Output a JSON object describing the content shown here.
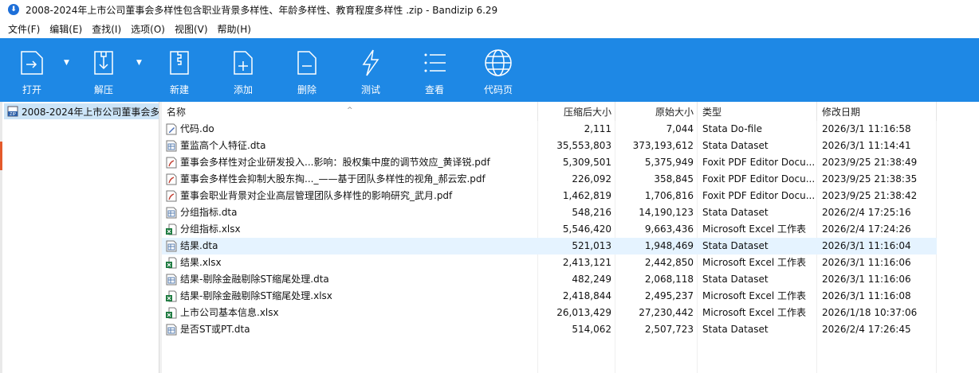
{
  "window": {
    "title": "2008-2024年上市公司董事会多样性包含职业背景多样性、年龄多样性、教育程度多样性 .zip - Bandizip 6.29"
  },
  "menu": [
    "文件(F)",
    "编辑(E)",
    "查找(I)",
    "选项(O)",
    "视图(V)",
    "帮助(H)"
  ],
  "toolbar": {
    "open": "打开",
    "extract": "解压",
    "new": "新建",
    "add": "添加",
    "delete": "删除",
    "test": "测试",
    "view": "查看",
    "codepage": "代码页"
  },
  "tree": {
    "root_label": "2008-2024年上市公司董事会多"
  },
  "columns": {
    "name": "名称",
    "packed": "压缩后大小",
    "size": "原始大小",
    "type": "类型",
    "modified": "修改日期"
  },
  "files": [
    {
      "name": "代码.do",
      "packed": "2,111",
      "size": "7,044",
      "type": "Stata Do-file",
      "modified": "2026/3/1 11:16:58",
      "icon": "do-file-icon"
    },
    {
      "name": "董监高个人特征.dta",
      "packed": "35,553,803",
      "size": "373,193,612",
      "type": "Stata Dataset",
      "modified": "2026/3/1 11:14:41",
      "icon": "dta-file-icon"
    },
    {
      "name": "董事会多样性对企业研发投入...影响：股权集中度的调节效应_黄译锐.pdf",
      "packed": "5,309,501",
      "size": "5,375,949",
      "type": "Foxit PDF Editor Docu...",
      "modified": "2023/9/25 21:38:49",
      "icon": "pdf-file-icon"
    },
    {
      "name": "董事会多样性会抑制大股东掏..._——基于团队多样性的视角_郝云宏.pdf",
      "packed": "226,092",
      "size": "358,845",
      "type": "Foxit PDF Editor Docu...",
      "modified": "2023/9/25 21:38:35",
      "icon": "pdf-file-icon"
    },
    {
      "name": "董事会职业背景对企业高层管理团队多样性的影响研究_武月.pdf",
      "packed": "1,462,819",
      "size": "1,706,816",
      "type": "Foxit PDF Editor Docu...",
      "modified": "2023/9/25 21:38:42",
      "icon": "pdf-file-icon"
    },
    {
      "name": "分组指标.dta",
      "packed": "548,216",
      "size": "14,190,123",
      "type": "Stata Dataset",
      "modified": "2026/2/4 17:25:16",
      "icon": "dta-file-icon"
    },
    {
      "name": "分组指标.xlsx",
      "packed": "5,546,420",
      "size": "9,663,436",
      "type": "Microsoft Excel 工作表",
      "modified": "2026/2/4 17:24:26",
      "icon": "xlsx-file-icon"
    },
    {
      "name": "结果.dta",
      "packed": "521,013",
      "size": "1,948,469",
      "type": "Stata Dataset",
      "modified": "2026/3/1 11:16:04",
      "icon": "dta-file-icon"
    },
    {
      "name": "结果.xlsx",
      "packed": "2,413,121",
      "size": "2,442,850",
      "type": "Microsoft Excel 工作表",
      "modified": "2026/3/1 11:16:06",
      "icon": "xlsx-file-icon"
    },
    {
      "name": "结果-剔除金融剔除ST缩尾处理.dta",
      "packed": "482,249",
      "size": "2,068,118",
      "type": "Stata Dataset",
      "modified": "2026/3/1 11:16:06",
      "icon": "dta-file-icon"
    },
    {
      "name": "结果-剔除金融剔除ST缩尾处理.xlsx",
      "packed": "2,418,844",
      "size": "2,495,237",
      "type": "Microsoft Excel 工作表",
      "modified": "2026/3/1 11:16:08",
      "icon": "xlsx-file-icon"
    },
    {
      "name": "上市公司基本信息.xlsx",
      "packed": "26,013,429",
      "size": "27,230,442",
      "type": "Microsoft Excel 工作表",
      "modified": "2026/1/18 10:37:06",
      "icon": "xlsx-file-icon"
    },
    {
      "name": "是否ST或PT.dta",
      "packed": "514,062",
      "size": "2,507,723",
      "type": "Stata Dataset",
      "modified": "2026/2/4 17:26:45",
      "icon": "dta-file-icon"
    }
  ],
  "colors": {
    "toolbar_bg": "#1e88e5",
    "selected_row": "#e5f3ff",
    "tree_selected": "#cce4f7"
  }
}
